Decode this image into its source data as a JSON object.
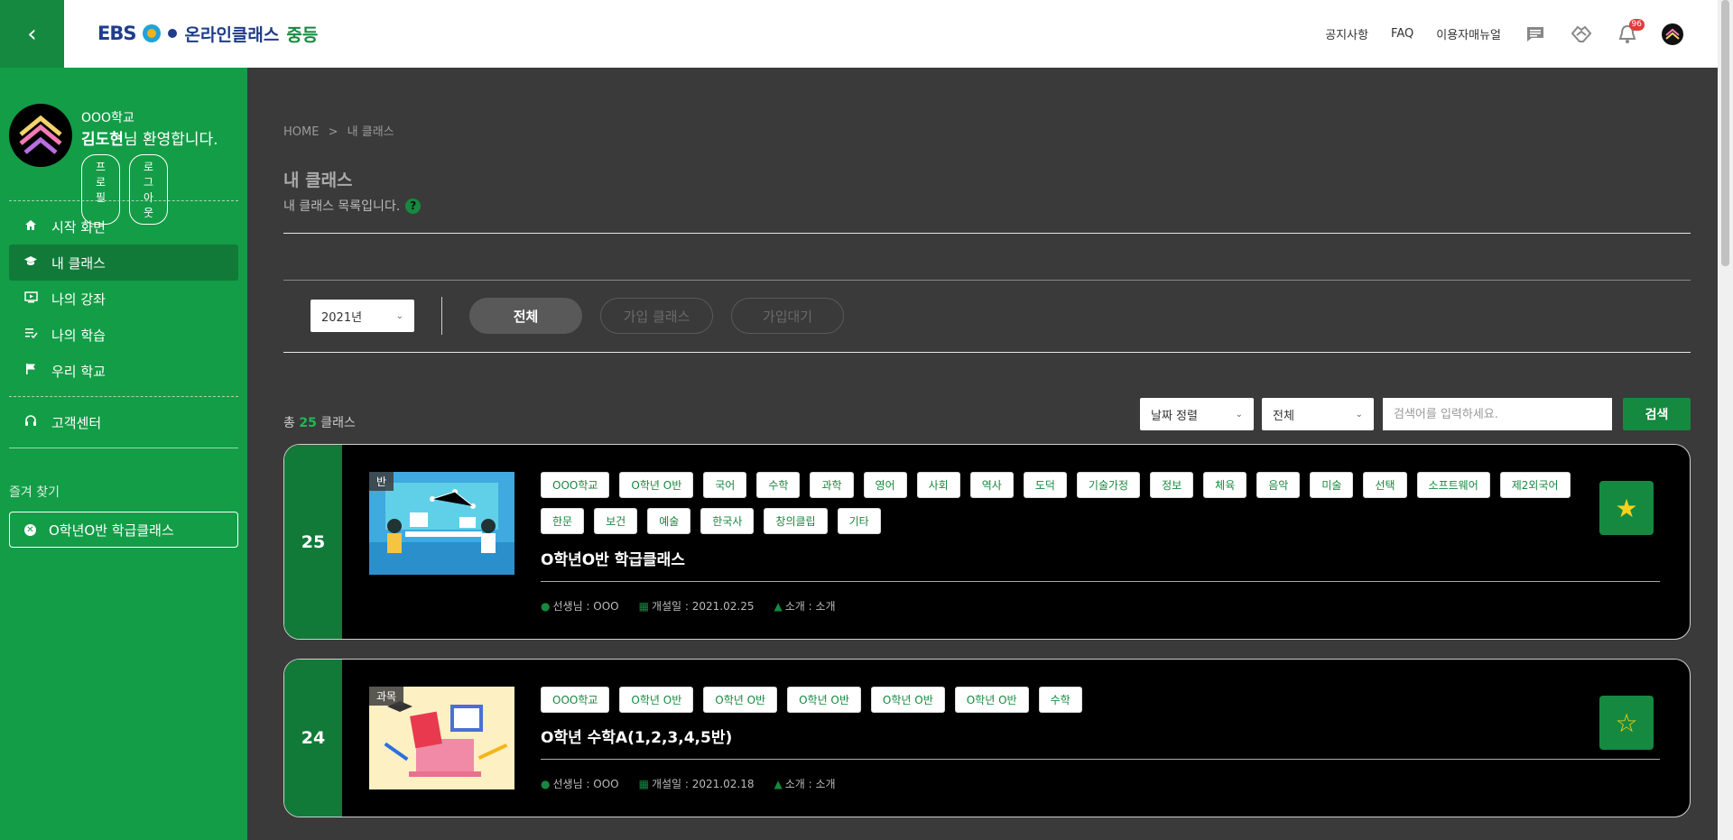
{
  "header": {
    "back_icon": "chevron-left-icon",
    "logo": {
      "ebs": "EBS",
      "brand": "온라인클래스",
      "sub": "중등"
    },
    "links": [
      "공지사항",
      "FAQ",
      "이용자매뉴얼"
    ],
    "notification_count": "96",
    "colors": {
      "accent": "#15893f"
    }
  },
  "sidebar": {
    "school": "OOO학교",
    "user_name": "김도현",
    "welcome_tail": "님 환영합니다.",
    "profile_btn": "프로필",
    "logout_btn": "로그아웃",
    "menu": [
      {
        "label": "시작 화면",
        "icon": "home-icon"
      },
      {
        "label": "내 클래스",
        "icon": "graduation-cap-icon"
      },
      {
        "label": "나의 강좌",
        "icon": "play-screen-icon"
      },
      {
        "label": "나의 학습",
        "icon": "checklist-icon"
      },
      {
        "label": "우리 학교",
        "icon": "flag-icon"
      }
    ],
    "support": "고객센터",
    "fav_title": "즐겨 찾기",
    "fav_item": "O학년O반 학급클래스"
  },
  "main": {
    "breadcrumb_home": "HOME",
    "breadcrumb_sep": ">",
    "breadcrumb_current": "내 클래스",
    "title": "내 클래스",
    "desc": "내 클래스 목록입니다.",
    "year": "2021년",
    "tabs": [
      "전체",
      "가입 클래스",
      "가입대기"
    ],
    "count_prefix": "총 ",
    "count": "25",
    "count_suffix": " 클래스",
    "sort": "날짜 정렬",
    "filter": "전체",
    "search_placeholder": "검색어를 입력하세요.",
    "search_btn": "검색"
  },
  "cards": [
    {
      "number": "25",
      "thumb_tag": "반",
      "tags": [
        "OOO학교",
        "O학년 O반",
        "국어",
        "수학",
        "과학",
        "영어",
        "사회",
        "역사",
        "도덕",
        "기술가정",
        "정보",
        "체육",
        "음악",
        "미술",
        "선택",
        "소프트웨어",
        "제2외국어",
        "한문",
        "보건",
        "예술",
        "한국사",
        "창의클립",
        "기타"
      ],
      "title": "O학년O반 학급클래스",
      "teacher": "선생님 : OOO",
      "opened": "개설일 : 2021.02.25",
      "intro": "소개 : 소개",
      "favorited": true
    },
    {
      "number": "24",
      "thumb_tag": "과목",
      "tags": [
        "OOO학교",
        "O학년 O반",
        "O학년 O반",
        "O학년 O반",
        "O학년 O반",
        "O학년 O반",
        "수학"
      ],
      "title": "O학년 수학A(1,2,3,4,5반)",
      "teacher": "선생님 : OOO",
      "opened": "개설일 : 2021.02.18",
      "intro": "소개 : 소개",
      "favorited": false
    }
  ]
}
